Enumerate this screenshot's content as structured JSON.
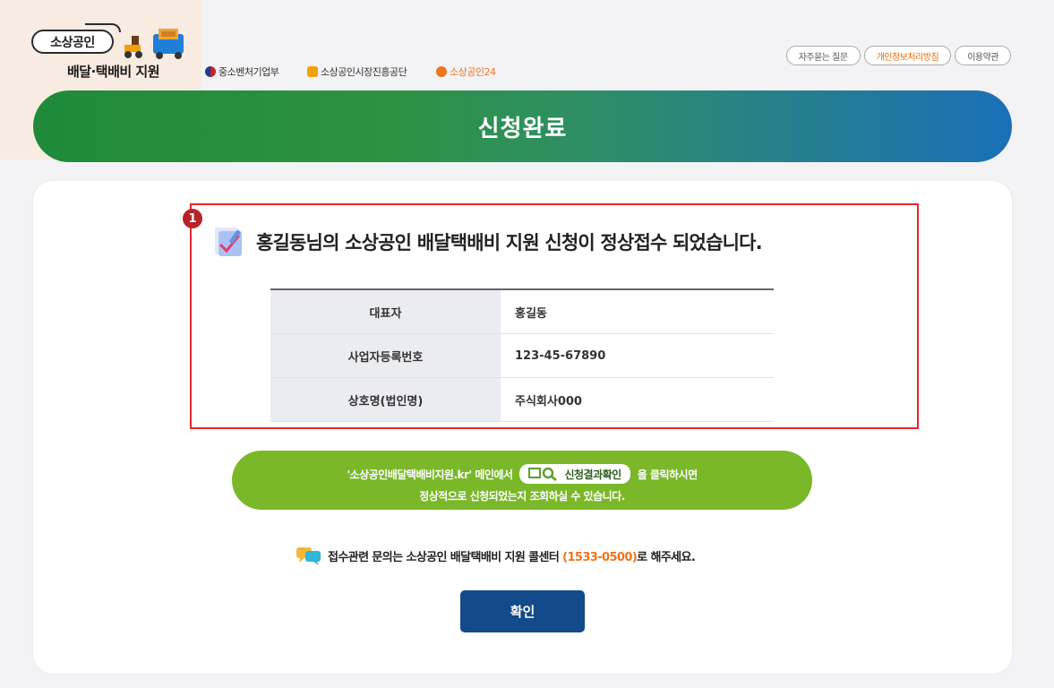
{
  "header": {
    "logo_main": "소상공인",
    "logo_sub": "배달·택배비 지원",
    "orgs": [
      {
        "name": "중소벤처기업부",
        "icon": "mss-emblem-icon",
        "color": "#1d3b8f"
      },
      {
        "name": "소상공인시장진흥공단",
        "icon": "semas-logo-icon",
        "color": "#f2a007"
      },
      {
        "name": "소상공인24",
        "icon": "sbiz24-logo-icon",
        "color": "#f07418"
      }
    ],
    "links": [
      "자주묻는 질문",
      "개인정보처리방침",
      "이용약관"
    ]
  },
  "banner": {
    "title": "신청완료"
  },
  "result": {
    "step_number": "1",
    "message": "홍길동님의 소상공인 배달택배비 지원 신청이 정상접수 되었습니다.",
    "rows": [
      {
        "label": "대표자",
        "value": "홍길동"
      },
      {
        "label": "사업자등록번호",
        "value": "123-45-67890"
      },
      {
        "label": "상호명(법인명)",
        "value": "주식회사000"
      }
    ]
  },
  "guide": {
    "prefix": "'소상공인배달택배비지원.kr' 메인에서",
    "button_label": "신청결과확인",
    "suffix": "을 클릭하시면",
    "line2": "정상적으로 신청되었는지 조회하실 수 있습니다."
  },
  "contact": {
    "text_before": "접수관련 문의는 소상공인 배달택배비 지원 콜센터 ",
    "phone": "(1533-0500)",
    "text_after": "로 해주세요."
  },
  "confirm": {
    "label": "확인"
  },
  "colors": {
    "banner_green": "#2d9240",
    "banner_blue": "#1b6fb8",
    "guide_green": "#7ab829",
    "confirm_navy": "#124a8a",
    "highlight_red": "#e4262e",
    "phone_orange": "#f07418"
  }
}
